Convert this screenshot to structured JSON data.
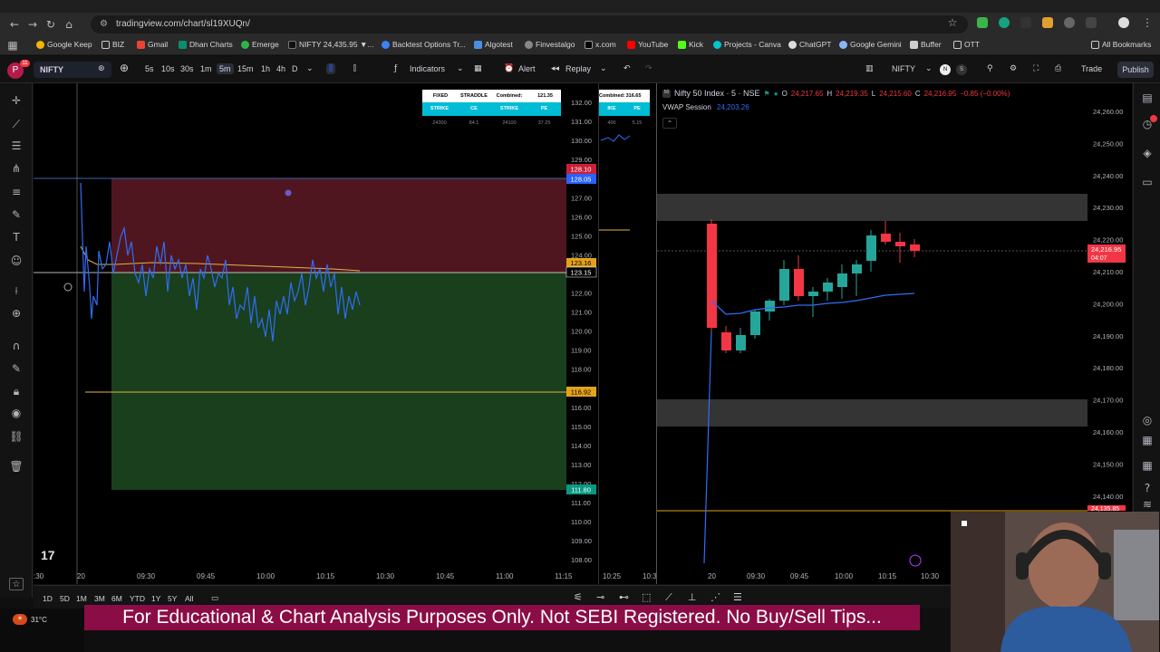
{
  "browser": {
    "url": "tradingview.com/chart/sl19XUQn/",
    "bookmarks": [
      "Google Keep",
      "BIZ",
      "Gmail",
      "Dhan Charts",
      "Emerge",
      "NIFTY 24,435.95 ▼...",
      "Backtest Options Tr...",
      "Algotest",
      "Finvestalgo",
      "x.com",
      "YouTube",
      "Kick",
      "Projects - Canva",
      "ChatGPT",
      "Google Gemini",
      "Buffer",
      "OTT"
    ],
    "all_bookmarks": "All Bookmarks"
  },
  "toolbar": {
    "avatar_letter": "P",
    "avatar_badge": "11",
    "symbol": "NIFTY",
    "intervals": [
      "5s",
      "10s",
      "30s",
      "1m",
      "5m",
      "15m",
      "1h",
      "4h",
      "D"
    ],
    "selected_interval": "5m",
    "indicators_label": "Indicators",
    "alert_label": "Alert",
    "replay_label": "Replay",
    "right_symbol": "NIFTY",
    "right_symbol_badge1": "N",
    "right_symbol_badge2": "S",
    "trade_label": "Trade",
    "publish_label": "Publish"
  },
  "left_chart": {
    "price_ticks": [
      "132.00",
      "131.00",
      "130.00",
      "129.00",
      "128.00",
      "127.00",
      "126.00",
      "125.00",
      "124.00",
      "123.00",
      "122.00",
      "121.00",
      "120.00",
      "119.00",
      "118.00",
      "117.00",
      "116.00",
      "115.00",
      "114.00",
      "113.00",
      "112.00",
      "111.00",
      "110.00",
      "109.00",
      "108.00"
    ],
    "price_labels": {
      "stop": "128.10",
      "current": "128.05",
      "entry_top": "123.16",
      "entry": "123.15",
      "level": "116.92",
      "target": "111.80"
    },
    "time_ticks": [
      ":30",
      "20",
      "09:30",
      "09:45",
      "10:00",
      "10:15",
      "10:30",
      "10:45",
      "11:00",
      "11:15"
    ],
    "tv_logo": "17"
  },
  "straddle_table": {
    "header": [
      "FIXED",
      "STRADDLE",
      "Combined:",
      "121.35"
    ],
    "cols": [
      "STRIKE",
      "CE",
      "STRIKE",
      "PE"
    ],
    "row": [
      "24300",
      "84.1",
      "24100",
      "37.25"
    ],
    "partial_header": "Combined:",
    "partial_value": "316.65",
    "partial_cols": [
      "IKE",
      "PE"
    ],
    "partial_row": [
      "400",
      "5.15"
    ]
  },
  "mid_chart": {
    "time_ticks": [
      "10:25",
      "10:30"
    ]
  },
  "right_chart": {
    "title": "Nifty 50 Index · 5 · NSE",
    "ohlc": {
      "o_label": "O",
      "o": "24,217.65",
      "h_label": "H",
      "h": "24,219.35",
      "l_label": "L",
      "l": "24,215.60",
      "c_label": "C",
      "c": "24,216.95",
      "change": "−0.85 (−0.00%)"
    },
    "vwap_label": "VWAP Session",
    "vwap_value": "24,203.26",
    "price_ticks": [
      "24,260.00",
      "24,250.00",
      "24,240.00",
      "24,230.00",
      "24,220.00",
      "24,210.00",
      "24,200.00",
      "24,190.00",
      "24,180.00",
      "24,170.00",
      "24,160.00",
      "24,150.00",
      "24,140.00"
    ],
    "last_price": "24,216.95",
    "countdown": "04:07",
    "partial_price": "24,135.85",
    "time_ticks": [
      "20",
      "09:30",
      "09:45",
      "10:00",
      "10:15",
      "10:30"
    ]
  },
  "bottom": {
    "ranges": [
      "1D",
      "5D",
      "1M",
      "3M",
      "6M",
      "YTD",
      "1Y",
      "5Y",
      "All"
    ]
  },
  "taskbar": {
    "temp": "31°C"
  },
  "disclaimer": "For Educational & Chart Analysis Purposes Only. Not SEBI Registered. No Buy/Sell Tips..."
}
